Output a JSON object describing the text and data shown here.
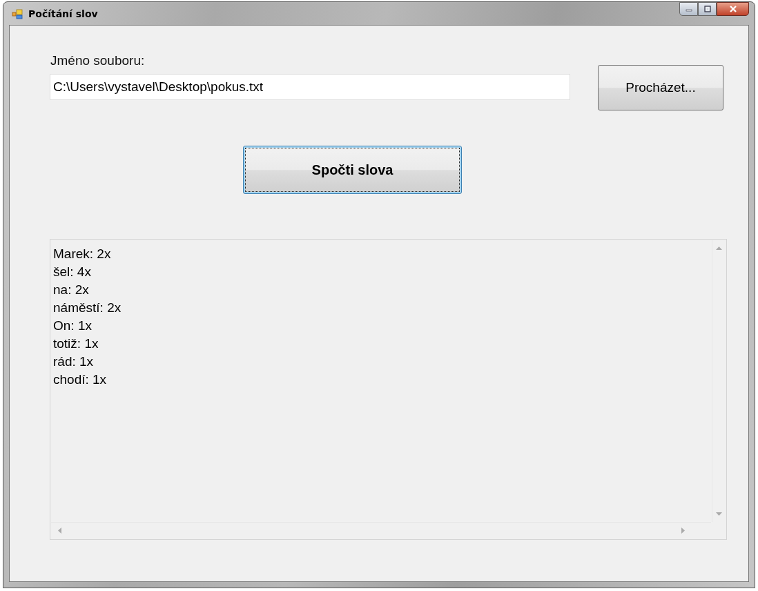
{
  "window": {
    "title": "Počítání slov"
  },
  "file_label": "Jméno souboru:",
  "file_field": {
    "value": "C:\\Users\\vystavel\\Desktop\\pokus.txt"
  },
  "browse_button": "Procházet...",
  "count_button": {
    "label": "Spočti slova",
    "focused": true
  },
  "output_lines": [
    "Marek: 2x",
    "šel: 4x",
    "na: 2x",
    "náměstí: 2x",
    "On: 1x",
    "totiž: 1x",
    "rád: 1x",
    "chodí: 1x"
  ]
}
